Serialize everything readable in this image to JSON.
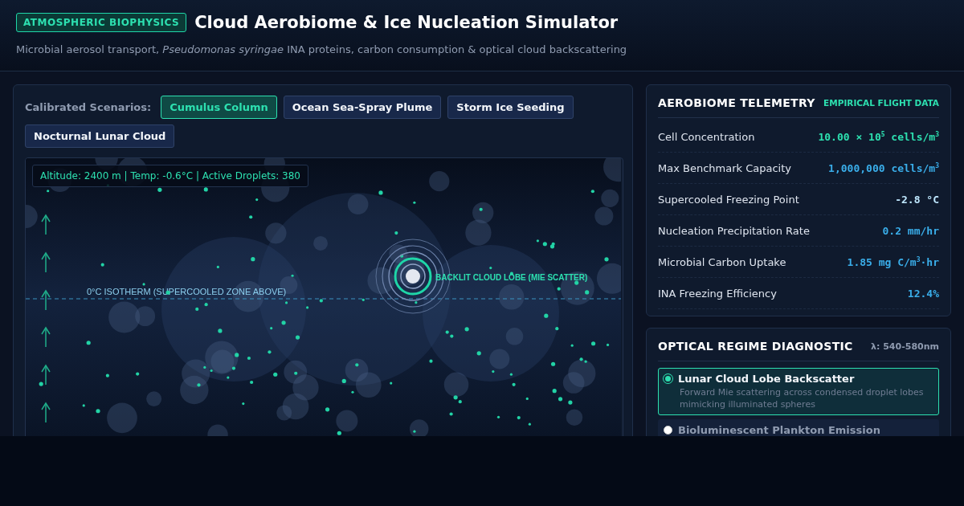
{
  "header": {
    "badge": "ATMOSPHERIC BIOPHYSICS",
    "title": "Cloud Aerobiome & Ice Nucleation Simulator",
    "subtitle": "Microbial aerosol transport, *Pseudomonas syringae* INA proteins, carbon consumption & optical cloud backscattering"
  },
  "scenarios": {
    "label": "Calibrated Scenarios:",
    "items": [
      {
        "label": "Cumulus Column",
        "selected": true
      },
      {
        "label": "Ocean Sea-Spray Plume",
        "selected": false
      },
      {
        "label": "Storm Ice Seeding",
        "selected": false
      },
      {
        "label": "Nocturnal Lunar Cloud",
        "selected": false
      }
    ]
  },
  "simulation": {
    "readout": "Altitude: 2400 m | Temp: -0.6°C | Active Droplets: 380",
    "isotherm_label": "0°C ISOTHERM (SUPERCOOLED ZONE ABOVE)",
    "target_label": "BACKLIT CLOUD LOBE (MIE SCATTER)"
  },
  "telemetry": {
    "title": "AEROBIOME TELEMETRY",
    "tag": "EMPIRICAL FLIGHT DATA",
    "rows": [
      {
        "label": "Cell Concentration",
        "value": "10.00 × 10$^{5}$ cells/m$^{3}$",
        "kind": "highlight"
      },
      {
        "label": "Max Benchmark Capacity",
        "value": "1,000,000 cells/m$^{3}$",
        "kind": "standard"
      },
      {
        "label": "Supercooled Freezing Point",
        "value": "-2.8 °C",
        "kind": "critical"
      },
      {
        "label": "Nucleation Precipitation Rate",
        "value": "0.2 mm/hr",
        "kind": "standard"
      },
      {
        "label": "Microbial Carbon Uptake",
        "value": "1.85 mg C/m$^{3}$·hr",
        "kind": "standard"
      },
      {
        "label": "INA Freezing Efficiency",
        "value": "12.4%",
        "kind": "standard"
      }
    ]
  },
  "optical": {
    "title": "OPTICAL REGIME DIAGNOSTIC",
    "wavelength": "λ: 540-580nm",
    "options": [
      {
        "title": "Lunar Cloud Lobe Backscatter",
        "description": "Forward Mie scattering across condensed droplet lobes mimicking illuminated spheres",
        "selected": true
      },
      {
        "title": "Bioluminescent Plankton Emission",
        "selected": false
      }
    ]
  }
}
